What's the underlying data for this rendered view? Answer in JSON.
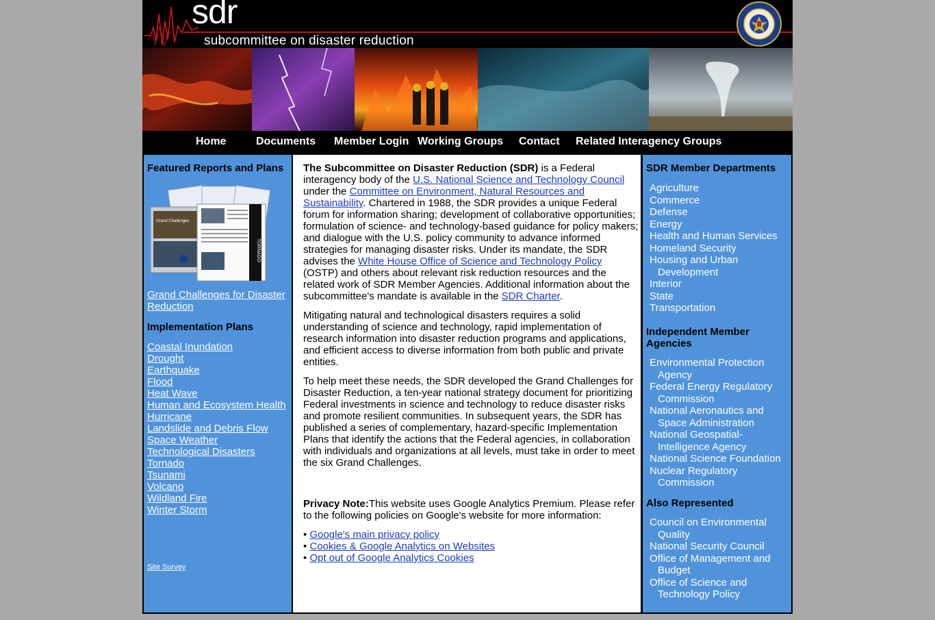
{
  "header": {
    "logo_main": "sdr",
    "logo_sub": "subcommittee on disaster reduction",
    "seal_alt": "EXECUTIVE OFFICE OF THE PRESIDENT OF THE UNITED STATES"
  },
  "nav": {
    "items": [
      "Home",
      "Documents",
      "Member Login",
      "Working Groups",
      "Contact",
      "Related Interagency Groups"
    ]
  },
  "left": {
    "featured_heading": "Featured Reports and Plans",
    "cover_title": "Grand Challenges for Disaster Reduction",
    "cover_spine": "TORNADO",
    "grand_challenges_link": "Grand Challenges for Disaster Reduction",
    "impl_heading": "Implementation Plans",
    "impl_links": [
      "Coastal Inundation",
      "Drought",
      "Earthquake",
      "Flood",
      "Heat Wave",
      "Human and Ecosystem Health",
      "Hurricane",
      "Landslide and Debris Flow",
      "Space Weather",
      "Technological Disasters",
      "Tornado",
      "Tsunami",
      "Volcano",
      "Wildland Fire",
      "Winter Storm"
    ],
    "survey_link": "Site Survey"
  },
  "center": {
    "p1": {
      "bold": "The Subcommittee on Disaster Reduction (SDR)",
      "t1": " is a Federal interagency body of the ",
      "l1": "U.S. National Science and Technology Council",
      "t2": " under the ",
      "l2": "Committee on Environment, Natural Resources and Sustainability",
      "t3": ". Chartered in 1988, the SDR provides a unique Federal forum for information sharing; development of collaborative opportunities; formulation of science- and technology-based guidance for policy makers; and dialogue with the U.S. policy community to advance informed strategies for managing disaster risks. Under its mandate, the SDR advises the ",
      "l3": "White House Office of Science and Technology Policy",
      "t4": " (OSTP) and others about relevant risk reduction resources and the related work of SDR Member Agencies. Additional information about the subcommittee's mandate is available in the ",
      "l4": "SDR Charter",
      "t5": "."
    },
    "p2": "Mitigating natural and technological disasters requires a solid understanding of science and technology, rapid implementation of research information into disaster reduction programs and applications, and efficient access to diverse information from both public and private entities.",
    "p3": "To help meet these needs, the SDR developed the Grand Challenges for Disaster Reduction, a ten-year national strategy document for prioritizing Federal investments in science and technology to reduce disaster risks and promote resilient communities. In subsequent years, the SDR has published a series of complementary, hazard-specific Implementation Plans that identify the actions that the Federal agencies, in collaboration with individuals and organizations at all levels, must take in order to meet the six Grand Challenges.",
    "privacy_bold": "Privacy Note:",
    "privacy_text": "This website uses Google Analytics Premium. Please refer to the following policies on Google's website for more information:",
    "policy_links": [
      "Google's main privacy policy",
      "Cookies & Google Analytics on Websites",
      "Opt out of Google Analytics Cookies"
    ],
    "bullet": "•"
  },
  "right": {
    "members_heading": "SDR Member Departments",
    "departments": [
      "Agriculture",
      "Commerce",
      "Defense",
      "Energy",
      "Health and Human Services",
      "Homeland Security",
      "Housing and Urban Development",
      "Interior",
      "State",
      "Transportation"
    ],
    "independent_heading": "Independent Member Agencies",
    "agencies": [
      "Environmental Protection Agency",
      "Federal Energy Regulatory Commission",
      "National Aeronautics and Space Administration",
      "National Geospatial-Intelligence Agency",
      "National Science Foundation",
      "Nuclear Regulatory Commission"
    ],
    "also_heading": "Also Represented",
    "also": [
      "Council on Environmental Quality",
      "National Security Council",
      "Office of Management and Budget",
      "Office of Science and Technology Policy"
    ]
  },
  "colors": {
    "page_background": "#a9a9a9",
    "column_blue": "#5193db",
    "link_blue": "#1a3cc0",
    "accent_red": "#c01010"
  }
}
